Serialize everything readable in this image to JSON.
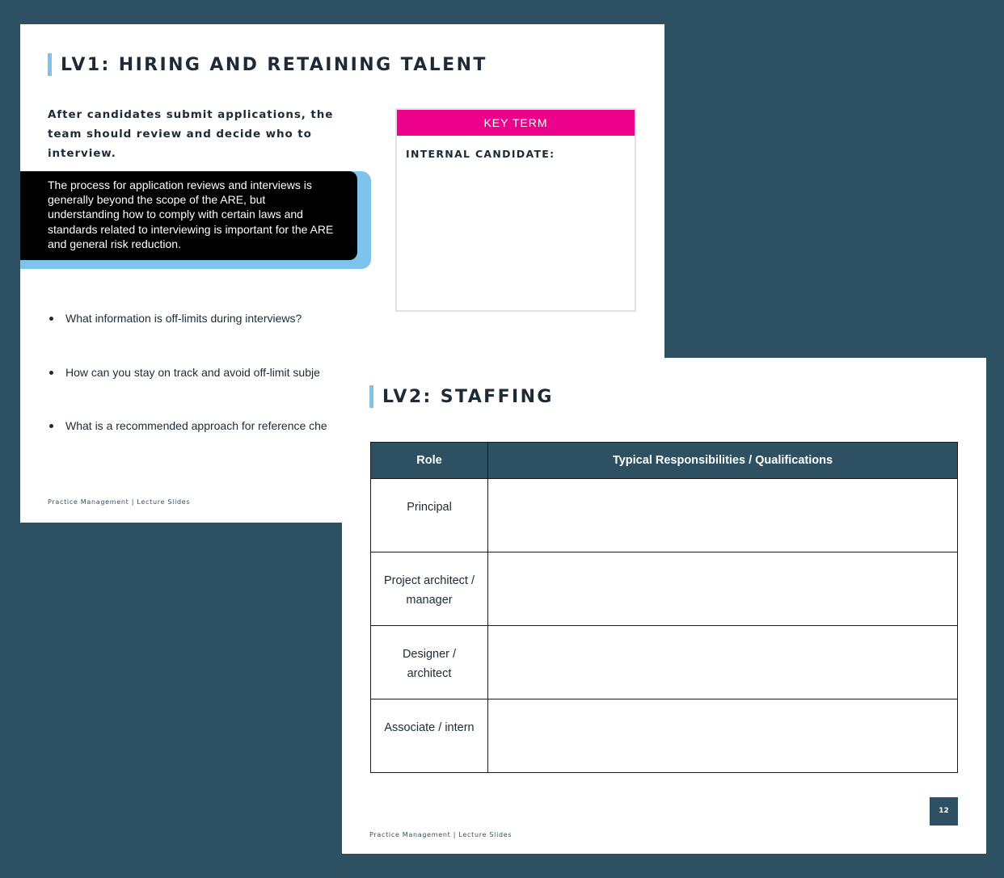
{
  "slide1": {
    "title": "LV1: HIRING AND RETAINING TALENT",
    "intro": "After candidates submit applications, the team should review and decide who to interview.",
    "callout": "The process for application reviews and interviews is generally beyond the scope of the ARE, but understanding how to comply with certain laws and standards related to interviewing is important for the ARE and general risk reduction.",
    "key_term": {
      "header": "KEY TERM",
      "label": "INTERNAL CANDIDATE:"
    },
    "bullets": [
      "What information is off-limits during interviews?",
      "How can you stay on track and avoid off-limit subje",
      "What is a recommended approach for reference che"
    ],
    "footer": "Practice Management | Lecture Slides"
  },
  "slide2": {
    "title": "LV2: STAFFING",
    "table": {
      "headers": [
        "Role",
        "Typical Responsibilities / Qualifications"
      ],
      "rows": [
        {
          "role": "Principal",
          "responsibilities": ""
        },
        {
          "role": "Project architect / manager",
          "responsibilities": ""
        },
        {
          "role": "Designer / architect",
          "responsibilities": ""
        },
        {
          "role": "Associate / intern",
          "responsibilities": ""
        }
      ]
    },
    "page_number": "12",
    "footer": "Practice Management | Lecture Slides"
  },
  "colors": {
    "background": "#2d5063",
    "accent_bar": "#7ec3ec",
    "key_term_header": "#ec008c",
    "table_header": "#2d5063"
  }
}
